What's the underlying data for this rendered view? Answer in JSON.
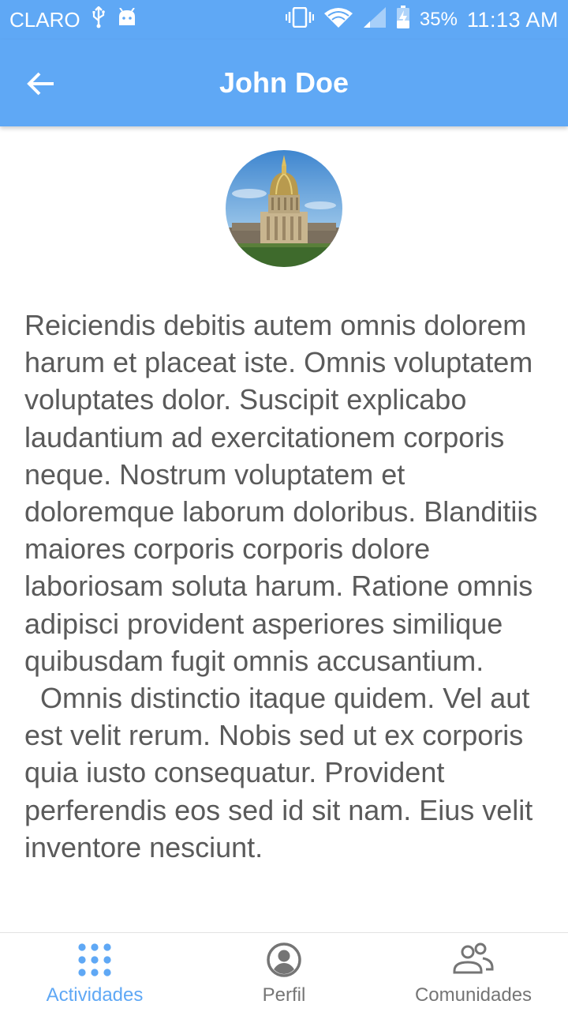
{
  "status_bar": {
    "carrier": "CLARO",
    "battery": "35%",
    "time": "11:13 AM",
    "icons": [
      "usb-icon",
      "android-icon",
      "vibrate-icon",
      "wifi-icon",
      "signal-icon",
      "battery-charging-icon"
    ]
  },
  "app_bar": {
    "title": "John Doe",
    "back_icon": "arrow-back-icon",
    "color": "#5fa8f5"
  },
  "profile": {
    "avatar": "photo of a domed building"
  },
  "content": {
    "paragraphs": [
      "Reiciendis debitis autem omnis dolorem harum et placeat iste. Omnis voluptatem voluptates dolor. Suscipit explicabo laudantium ad exercitationem corporis neque. Nostrum voluptatem et doloremque laborum doloribus. Blanditiis maiores corporis corporis dolore laboriosam soluta harum. Ratione omnis adipisci provident asperiores similique quibusdam fugit omnis accusantium.",
      "Omnis distinctio itaque quidem. Vel aut est velit rerum. Nobis sed ut ex corporis quia iusto consequatur. Provident perferendis eos sed id sit nam. Eius velit inventore nesciunt."
    ]
  },
  "bottom_nav": {
    "items": [
      {
        "label": "Actividades",
        "icon": "apps-grid-icon",
        "active": true
      },
      {
        "label": "Perfil",
        "icon": "account-circle-icon",
        "active": false
      },
      {
        "label": "Comunidades",
        "icon": "people-icon",
        "active": false
      }
    ],
    "active_color": "#5fa8f5",
    "inactive_color": "#757575"
  }
}
